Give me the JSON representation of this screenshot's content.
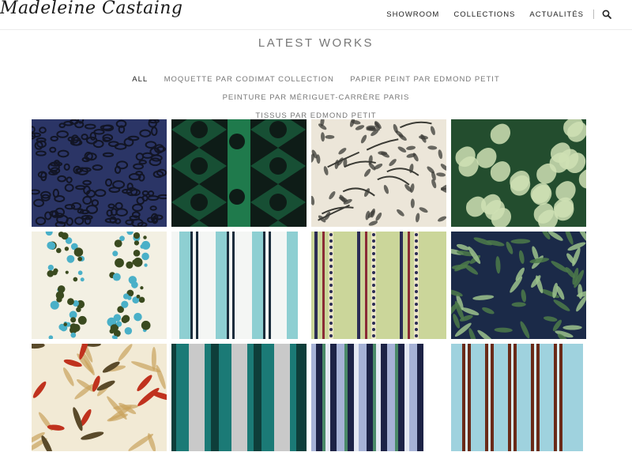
{
  "brand": {
    "logo_text": "Madeleine Castaing"
  },
  "nav": {
    "items": [
      {
        "label": "SHOWROOM"
      },
      {
        "label": "COLLECTIONS"
      },
      {
        "label": "ACTUALITÉS"
      }
    ],
    "search_icon": "search-icon"
  },
  "page": {
    "title": "LATEST WORKS"
  },
  "filters": {
    "items": [
      {
        "label": "ALL",
        "active": true
      },
      {
        "label": "MOQUETTE PAR CODIMAT COLLECTION"
      },
      {
        "label": "PAPIER PEINT PAR EDMOND PETIT"
      },
      {
        "label": "PEINTURE PAR MÉRIGUET-CARRÈRE PARIS"
      },
      {
        "label": "TISSUS PAR EDMOND PETIT"
      }
    ]
  },
  "gallery": {
    "tiles": [
      {
        "pattern": "leopard",
        "colors": [
          "#2b3566",
          "#121525"
        ]
      },
      {
        "pattern": "green-medallion",
        "colors": [
          "#1f7a4c",
          "#0e1c17"
        ]
      },
      {
        "pattern": "branches",
        "colors": [
          "#ece6d9",
          "#3b3b35"
        ]
      },
      {
        "pattern": "acanthus",
        "colors": [
          "#234d2e",
          "#cfe0b4"
        ]
      },
      {
        "pattern": "floral-stripe",
        "colors": [
          "#f3f0e3",
          "#3a4a1f",
          "#4ab0c8"
        ]
      },
      {
        "pattern": "blue-stripe",
        "colors": [
          "#f4f6f4",
          "#8ecfd2",
          "#1b2d3c"
        ]
      },
      {
        "pattern": "lime-stripe",
        "colors": [
          "#cbd69a",
          "#2b2c55",
          "#8a2b35"
        ]
      },
      {
        "pattern": "jungle",
        "colors": [
          "#1b2a48",
          "#4c7a4a",
          "#9cc28d"
        ]
      },
      {
        "pattern": "palm",
        "colors": [
          "#f2ead5",
          "#c0321e",
          "#5a4a2a",
          "#c9a35c"
        ]
      },
      {
        "pattern": "teal-stripe",
        "colors": [
          "#1b7a76",
          "#c9c9c9",
          "#0e3e3a"
        ]
      },
      {
        "pattern": "mixed-stripe",
        "colors": [
          "#1d2346",
          "#a6b2d6",
          "#4a8a68"
        ]
      },
      {
        "pattern": "sky-stripe",
        "colors": [
          "#9fd2de",
          "#6a2a18",
          "#d9eef2"
        ]
      }
    ]
  }
}
